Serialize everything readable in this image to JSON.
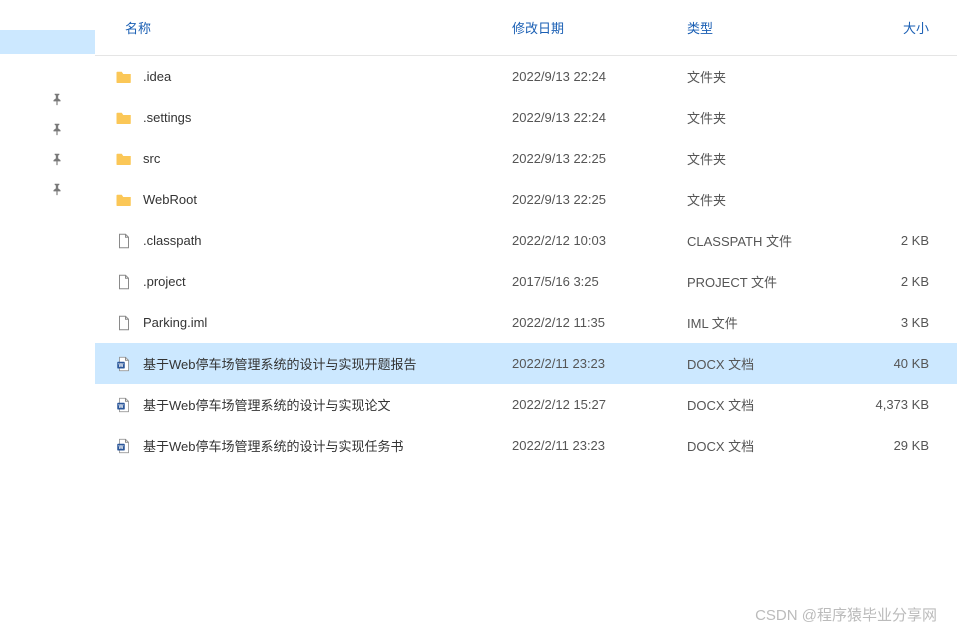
{
  "columns": {
    "name": "名称",
    "date": "修改日期",
    "type": "类型",
    "size": "大小"
  },
  "files": [
    {
      "icon": "folder",
      "name": ".idea",
      "date": "2022/9/13 22:24",
      "type": "文件夹",
      "size": ""
    },
    {
      "icon": "folder",
      "name": ".settings",
      "date": "2022/9/13 22:24",
      "type": "文件夹",
      "size": ""
    },
    {
      "icon": "folder",
      "name": "src",
      "date": "2022/9/13 22:25",
      "type": "文件夹",
      "size": ""
    },
    {
      "icon": "folder",
      "name": "WebRoot",
      "date": "2022/9/13 22:25",
      "type": "文件夹",
      "size": ""
    },
    {
      "icon": "file",
      "name": ".classpath",
      "date": "2022/2/12 10:03",
      "type": "CLASSPATH 文件",
      "size": "2 KB"
    },
    {
      "icon": "file",
      "name": ".project",
      "date": "2017/5/16 3:25",
      "type": "PROJECT 文件",
      "size": "2 KB"
    },
    {
      "icon": "file",
      "name": "Parking.iml",
      "date": "2022/2/12 11:35",
      "type": "IML 文件",
      "size": "3 KB"
    },
    {
      "icon": "docx",
      "name": "基于Web停车场管理系统的设计与实现开题报告",
      "date": "2022/2/11 23:23",
      "type": "DOCX 文档",
      "size": "40 KB",
      "selected": true
    },
    {
      "icon": "docx",
      "name": "基于Web停车场管理系统的设计与实现论文",
      "date": "2022/2/12 15:27",
      "type": "DOCX 文档",
      "size": "4,373 KB"
    },
    {
      "icon": "docx",
      "name": "基于Web停车场管理系统的设计与实现任务书",
      "date": "2022/2/11 23:23",
      "type": "DOCX 文档",
      "size": "29 KB"
    }
  ],
  "watermark": "CSDN @程序猿毕业分享网"
}
